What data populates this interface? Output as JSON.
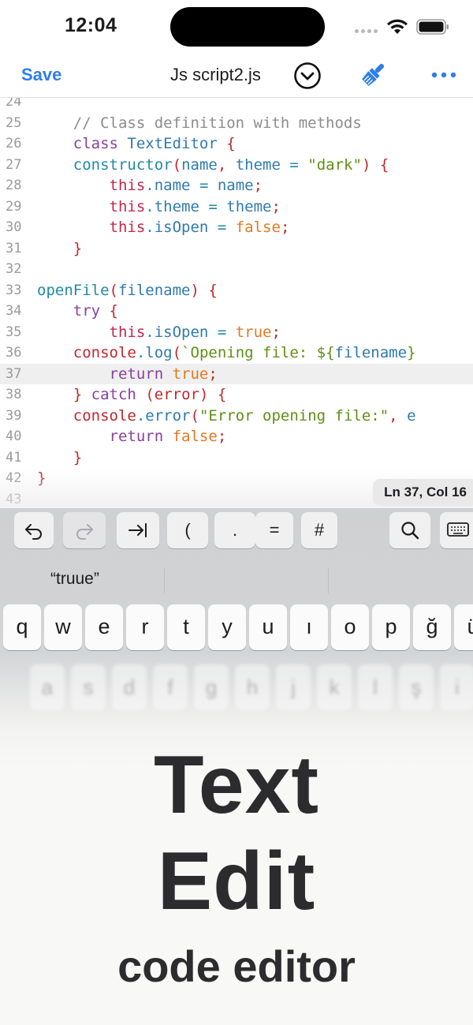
{
  "status_bar": {
    "time": "12:04"
  },
  "nav": {
    "save_label": "Save",
    "file_title": "Js script2.js"
  },
  "editor": {
    "cursor_status": "Ln 37, Col 16",
    "current_line": 37,
    "lines": [
      {
        "n": "24",
        "tokens": []
      },
      {
        "n": "25",
        "tokens": [
          [
            "",
            "    "
          ],
          [
            "cm",
            "// Class definition with methods"
          ]
        ]
      },
      {
        "n": "26",
        "tokens": [
          [
            "",
            "    "
          ],
          [
            "kw",
            "class"
          ],
          [
            "",
            " "
          ],
          [
            "cls",
            "TextEditor"
          ],
          [
            "",
            " "
          ],
          [
            "pn",
            "{"
          ]
        ]
      },
      {
        "n": "27",
        "tokens": [
          [
            "",
            "    "
          ],
          [
            "fn",
            "constructor"
          ],
          [
            "pn",
            "("
          ],
          [
            "pl",
            "name"
          ],
          [
            "pn",
            ","
          ],
          [
            "",
            " "
          ],
          [
            "pl",
            "theme"
          ],
          [
            "",
            " "
          ],
          [
            "op",
            "="
          ],
          [
            "",
            " "
          ],
          [
            "str",
            "\"dark\""
          ],
          [
            "pn",
            ")"
          ],
          [
            "",
            " "
          ],
          [
            "pn",
            "{"
          ]
        ]
      },
      {
        "n": "28",
        "tokens": [
          [
            "",
            "        "
          ],
          [
            "this",
            "this"
          ],
          [
            "op",
            "."
          ],
          [
            "prop",
            "name"
          ],
          [
            "",
            " "
          ],
          [
            "op",
            "="
          ],
          [
            "",
            " "
          ],
          [
            "pl",
            "name"
          ],
          [
            "pn",
            ";"
          ]
        ]
      },
      {
        "n": "29",
        "tokens": [
          [
            "",
            "        "
          ],
          [
            "this",
            "this"
          ],
          [
            "op",
            "."
          ],
          [
            "prop",
            "theme"
          ],
          [
            "",
            " "
          ],
          [
            "op",
            "="
          ],
          [
            "",
            " "
          ],
          [
            "pl",
            "theme"
          ],
          [
            "pn",
            ";"
          ]
        ]
      },
      {
        "n": "30",
        "tokens": [
          [
            "",
            "        "
          ],
          [
            "this",
            "this"
          ],
          [
            "op",
            "."
          ],
          [
            "prop",
            "isOpen"
          ],
          [
            "",
            " "
          ],
          [
            "op",
            "="
          ],
          [
            "",
            " "
          ],
          [
            "bool",
            "false"
          ],
          [
            "pn",
            ";"
          ]
        ]
      },
      {
        "n": "31",
        "tokens": [
          [
            "",
            "    "
          ],
          [
            "pn",
            "}"
          ]
        ]
      },
      {
        "n": "32",
        "tokens": []
      },
      {
        "n": "33",
        "tokens": [
          [
            "fn",
            "openFile"
          ],
          [
            "pn",
            "("
          ],
          [
            "pl",
            "filename"
          ],
          [
            "pn",
            ")"
          ],
          [
            "",
            " "
          ],
          [
            "pn",
            "{"
          ]
        ]
      },
      {
        "n": "34",
        "tokens": [
          [
            "",
            "    "
          ],
          [
            "kw",
            "try"
          ],
          [
            "",
            " "
          ],
          [
            "pn",
            "{"
          ]
        ]
      },
      {
        "n": "35",
        "tokens": [
          [
            "",
            "        "
          ],
          [
            "this",
            "this"
          ],
          [
            "op",
            "."
          ],
          [
            "prop",
            "isOpen"
          ],
          [
            "",
            " "
          ],
          [
            "op",
            "="
          ],
          [
            "",
            " "
          ],
          [
            "bool",
            "true"
          ],
          [
            "pn",
            ";"
          ]
        ]
      },
      {
        "n": "36",
        "tokens": [
          [
            "",
            "    "
          ],
          [
            "err",
            "console"
          ],
          [
            "op",
            "."
          ],
          [
            "log",
            "log"
          ],
          [
            "pn",
            "("
          ],
          [
            "bt",
            "`Opening file: ${"
          ],
          [
            "pl",
            "filename"
          ],
          [
            "bt",
            "}"
          ]
        ]
      },
      {
        "n": "37",
        "tokens": [
          [
            "",
            "        "
          ],
          [
            "kw",
            "return"
          ],
          [
            "",
            " "
          ],
          [
            "bool",
            "true"
          ],
          [
            "pn",
            ";"
          ]
        ]
      },
      {
        "n": "38",
        "tokens": [
          [
            "",
            "    "
          ],
          [
            "pn",
            "}"
          ],
          [
            "",
            " "
          ],
          [
            "kw",
            "catch"
          ],
          [
            "",
            " "
          ],
          [
            "pn",
            "("
          ],
          [
            "err",
            "error"
          ],
          [
            "pn",
            ")"
          ],
          [
            "",
            " "
          ],
          [
            "pn",
            "{"
          ]
        ]
      },
      {
        "n": "39",
        "tokens": [
          [
            "",
            "    "
          ],
          [
            "err",
            "console"
          ],
          [
            "op",
            "."
          ],
          [
            "log",
            "error"
          ],
          [
            "pn",
            "("
          ],
          [
            "str",
            "\"Error opening file:\""
          ],
          [
            "pn",
            ","
          ],
          [
            "",
            " "
          ],
          [
            "pl",
            "e"
          ]
        ]
      },
      {
        "n": "40",
        "tokens": [
          [
            "",
            "        "
          ],
          [
            "kw",
            "return"
          ],
          [
            "",
            " "
          ],
          [
            "bool",
            "false"
          ],
          [
            "pn",
            ";"
          ]
        ]
      },
      {
        "n": "41",
        "tokens": [
          [
            "",
            "    "
          ],
          [
            "pn",
            "}"
          ]
        ]
      },
      {
        "n": "42",
        "tokens": [
          [
            "pn",
            "}"
          ]
        ]
      },
      {
        "n": "43",
        "tokens": []
      }
    ]
  },
  "keyboard": {
    "toolbar": [
      "(",
      ".",
      "=",
      "#"
    ],
    "suggestion": "“truue”",
    "row1": [
      "q",
      "w",
      "e",
      "r",
      "t",
      "y",
      "u",
      "ı",
      "o",
      "p",
      "ğ",
      "ü"
    ],
    "row2": [
      "a",
      "s",
      "d",
      "f",
      "g",
      "h",
      "j",
      "k",
      "l",
      "ş",
      "i"
    ]
  },
  "promo": {
    "line1": "Text",
    "line2": "Edit",
    "line3": "code editor"
  },
  "colors": {
    "accent": "#2f7ee8",
    "promo_text": "#2c2c2e"
  }
}
